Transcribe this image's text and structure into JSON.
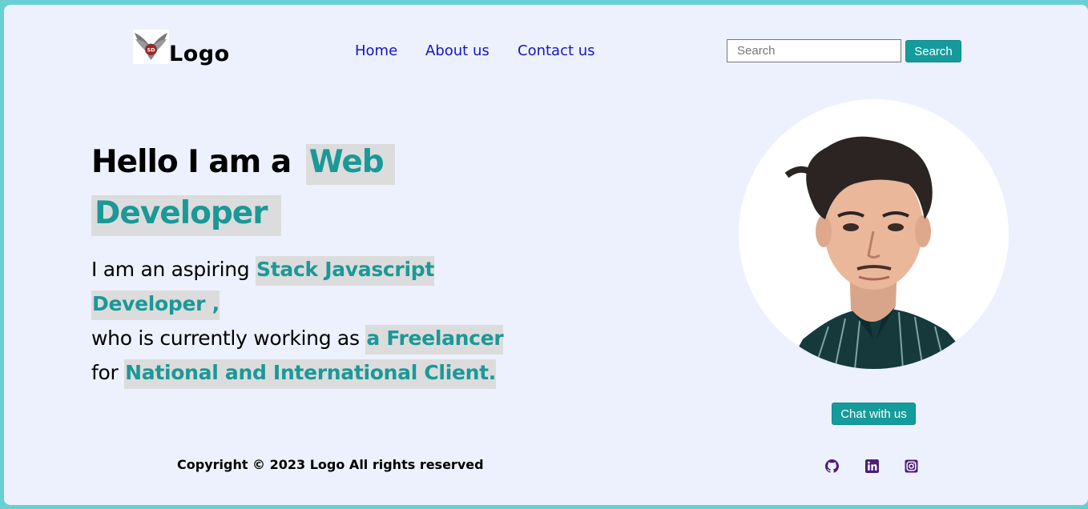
{
  "header": {
    "logo_text": "Logo",
    "logo_badge": "SD",
    "nav": [
      {
        "label": "Home"
      },
      {
        "label": "About us"
      },
      {
        "label": "Contact us"
      }
    ],
    "search": {
      "placeholder": "Search",
      "button_label": "Search"
    }
  },
  "hero": {
    "title_prefix": "Hello I am a",
    "title_highlight_1": "Web",
    "title_highlight_2": "Developer",
    "line1_prefix": "I am an aspiring",
    "line1_highlight": "Stack Javascript",
    "line1_highlight_cont": "Developer ,",
    "line2_prefix": "who is currently working as",
    "line2_highlight": "a Freelancer",
    "line3_prefix": "for",
    "line3_highlight": "National and International Client.",
    "chat_button": "Chat with us"
  },
  "footer": {
    "copyright": "Copyright © 2023 Logo All rights reserved",
    "social_icons": [
      "github-icon",
      "linkedin-icon",
      "instagram-icon"
    ]
  },
  "colors": {
    "accent": "#159b9b",
    "nav_link": "#1515c4",
    "highlight_bg": "#dcdcdc",
    "page_bg": "#edf1fd",
    "outer_bg": "#6acfd2",
    "social_icon": "#4b1d77"
  }
}
